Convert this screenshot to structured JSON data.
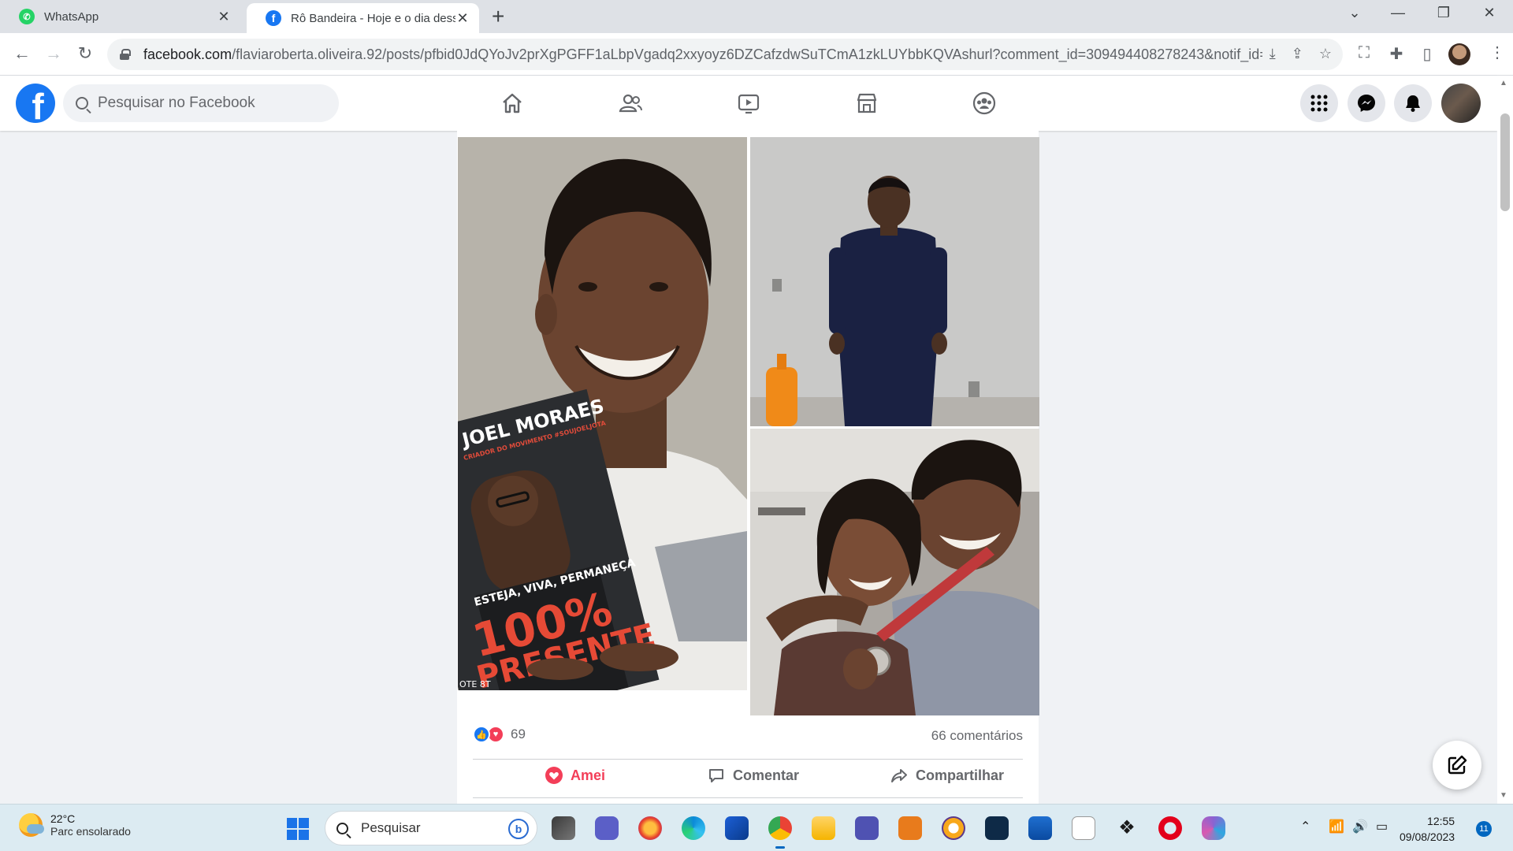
{
  "browser": {
    "tabs": [
      {
        "title": "WhatsApp",
        "active": false,
        "icon": "whatsapp-icon"
      },
      {
        "title": "Rô Bandeira - Hoje e o dia desse",
        "active": true,
        "icon": "facebook-icon"
      }
    ],
    "url_host": "facebook.com",
    "url_path": "/flaviaroberta.oliveira.92/posts/pfbid0JdQYoJv2prXgPGFF1aLbpVgadq2xxyoyz6DZCafzdwSuTCmA1zkLUYbbKQVAshurl?comment_id=309494408278243&notif_id=169..."
  },
  "facebook": {
    "search_placeholder": "Pesquisar no Facebook",
    "nav": [
      "home",
      "friends",
      "watch",
      "marketplace",
      "groups"
    ]
  },
  "post": {
    "reaction_count": "69",
    "comments_label": "66 comentários",
    "actions": {
      "love": "Amei",
      "comment": "Comentar",
      "share": "Compartilhar"
    },
    "photo_text": {
      "book_author": "JOEL MORAES",
      "book_subtitle": "CRIADOR DO MOVIMENTO #SOUJOELJOTA",
      "book_tagline": "ESTEJA, VIVA, PERMANEÇA",
      "book_title_1": "100%",
      "book_title_2": "PRESENTE",
      "corner_text": "OTE 8T"
    }
  },
  "taskbar": {
    "temperature": "22°C",
    "weather": "Parc ensolarado",
    "search_label": "Pesquisar",
    "time": "12:55",
    "date": "09/08/2023",
    "notifications": "11"
  },
  "colors": {
    "facebook_blue": "#1877f2",
    "love_red": "#f33e58",
    "muted_text": "#65676b"
  }
}
